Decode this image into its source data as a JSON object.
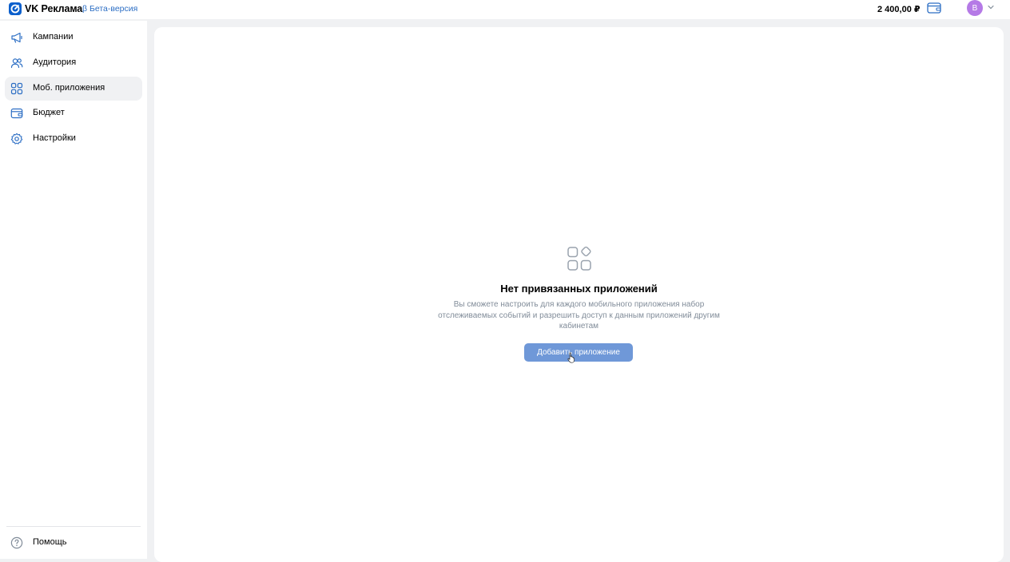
{
  "header": {
    "brand": "VK Реклама",
    "beta": "β Бета-версия",
    "balance": "2 400,00 ₽",
    "avatar_letter": "В"
  },
  "sidebar": {
    "items": [
      {
        "label": "Кампании",
        "icon": "megaphone-icon"
      },
      {
        "label": "Аудитория",
        "icon": "users-icon"
      },
      {
        "label": "Моб. приложения",
        "icon": "apps-grid-icon"
      },
      {
        "label": "Бюджет",
        "icon": "wallet-icon"
      },
      {
        "label": "Настройки",
        "icon": "gear-icon"
      }
    ],
    "help_label": "Помощь"
  },
  "empty_state": {
    "title": "Нет привязанных приложений",
    "description": "Вы сможете настроить для каждого мобильного приложения набор отслеживаемых событий и разрешить доступ к данным приложений другим кабинетам",
    "button_label": "Добавить приложение"
  },
  "colors": {
    "accent": "#2c6ec4",
    "button": "#6f98d8",
    "avatar": "#b57ae6",
    "muted_text": "#818c99"
  }
}
